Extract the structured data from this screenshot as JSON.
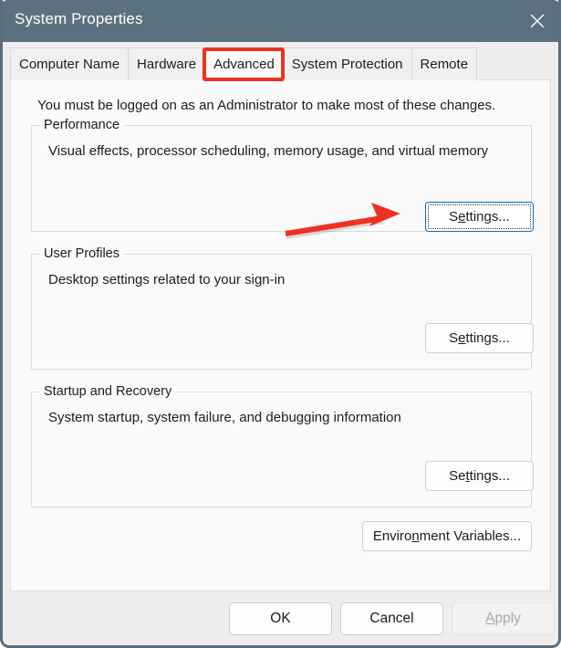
{
  "window": {
    "title": "System Properties",
    "close_icon": "close-icon",
    "titlebar_color": "#5c7180",
    "accent_focus_color": "#0f6cbd",
    "annotation_color": "#ef3124"
  },
  "tabs": [
    {
      "label": "Computer Name",
      "active": false
    },
    {
      "label": "Hardware",
      "active": false
    },
    {
      "label": "Advanced",
      "active": true
    },
    {
      "label": "System Protection",
      "active": false
    },
    {
      "label": "Remote",
      "active": false
    }
  ],
  "panel": {
    "admin_note": "You must be logged on as an Administrator to make most of these changes."
  },
  "groups": [
    {
      "label": "Performance",
      "description": "Visual effects, processor scheduling, memory usage, and virtual memory",
      "button": {
        "pre": "S",
        "accel": "e",
        "post": "ttings...",
        "focused": true
      }
    },
    {
      "label": "User Profiles",
      "description": "Desktop settings related to your sign-in",
      "button": {
        "pre": "S",
        "accel": "e",
        "post": "ttings...",
        "focused": false
      }
    },
    {
      "label": "Startup and Recovery",
      "description": "System startup, system failure, and debugging information",
      "button": {
        "pre": "Se",
        "accel": "t",
        "post": "tings...",
        "focused": false
      }
    }
  ],
  "environment_variables_button": {
    "pre": "Enviro",
    "accel": "n",
    "post": "ment Variables..."
  },
  "footer": {
    "ok": {
      "label": "OK"
    },
    "cancel": {
      "label": "Cancel"
    },
    "apply": {
      "pre": "",
      "accel": "A",
      "post": "pply",
      "disabled": true
    }
  },
  "annotations": {
    "tab_highlight_target": "Advanced",
    "arrow_target": "performance-settings-button"
  }
}
